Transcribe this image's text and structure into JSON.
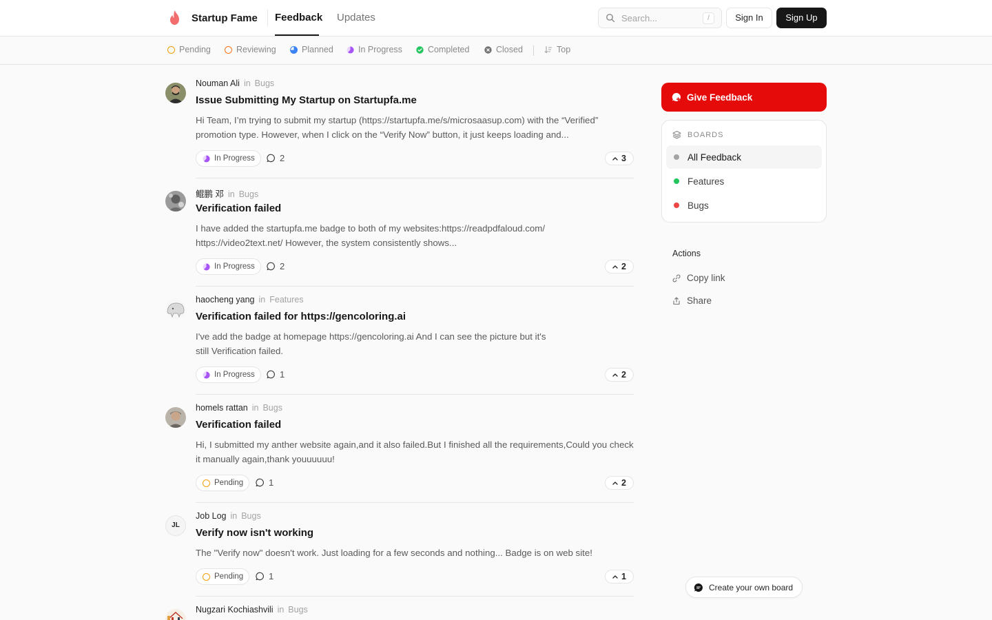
{
  "header": {
    "brand": "Startup Fame",
    "tabs": [
      {
        "label": "Feedback",
        "active": true
      },
      {
        "label": "Updates",
        "active": false
      }
    ],
    "search_placeholder": "Search...",
    "search_shortcut": "/",
    "sign_in": "Sign In",
    "sign_up": "Sign Up"
  },
  "status_filters": [
    {
      "label": "Pending",
      "icon": "pending-ring-icon",
      "color": "#f59e0b"
    },
    {
      "label": "Reviewing",
      "icon": "reviewing-ring-icon",
      "color": "#f97316"
    },
    {
      "label": "Planned",
      "icon": "planned-icon",
      "color": "#3b82f6"
    },
    {
      "label": "In Progress",
      "icon": "in-progress-icon",
      "color": "#a855f7"
    },
    {
      "label": "Completed",
      "icon": "completed-check-icon",
      "color": "#22c55e"
    },
    {
      "label": "Closed",
      "icon": "closed-x-icon",
      "color": "#737373"
    },
    {
      "label": "Top",
      "icon": "sort-icon",
      "color": "#a3a3a3"
    }
  ],
  "posts": [
    {
      "author": "Nouman Ali",
      "in": "in",
      "board": "Bugs",
      "title": "Issue Submitting My Startup on Startupfa.me",
      "description": "Hi Team, I’m trying to submit my startup (https://startupfa.me/s/microsaasup.com) with the “Verified” promotion type. However, when I click on the “Verify Now” button, it just keeps loading and...",
      "status": "In Progress",
      "comments": "2",
      "upvotes": "3"
    },
    {
      "author": "鲲鹏 邓",
      "in": "in",
      "board": "Bugs",
      "title": "Verification failed",
      "description": "I have added the startupfa.me badge to both of my websites:https://readpdfaloud.com/ https://video2text.net/ However, the system consistently shows...",
      "status": "In Progress",
      "comments": "2",
      "upvotes": "2"
    },
    {
      "author": "haocheng yang",
      "in": "in",
      "board": "Features",
      "title": "Verification failed for https://gencoloring.ai",
      "description_lines": [
        "I've add the badge at homepage https://gencoloring.ai  And I can see the picture but it's",
        "still Verification failed."
      ],
      "status": "In Progress",
      "comments": "1",
      "upvotes": "2"
    },
    {
      "author": "homels rattan",
      "in": "in",
      "board": "Bugs",
      "title": "Verification failed",
      "description": "Hi, I submitted my anther website again,and it also failed.But I finished all the requirements,Could you check it manually again,thank youuuuuu!",
      "status": "Pending",
      "comments": "1",
      "upvotes": "2"
    },
    {
      "author": "Job Log",
      "initials": "JL",
      "in": "in",
      "board": "Bugs",
      "title": "Verify now isn't working",
      "description": "The \"Verify now\" doesn't work. Just loading for a few seconds and nothing... Badge is on web site!",
      "status": "Pending",
      "comments": "1",
      "upvotes": "1"
    },
    {
      "author": "Nugzari Kochiashvili",
      "in": "in",
      "board": "Bugs"
    }
  ],
  "sidebar": {
    "give_feedback": "Give Feedback",
    "boards_heading": "BOARDS",
    "boards": [
      {
        "label": "All Feedback",
        "color": "#a3a3a3",
        "active": true
      },
      {
        "label": "Features",
        "color": "#22c55e",
        "active": false
      },
      {
        "label": "Bugs",
        "color": "#ef4444",
        "active": false
      }
    ],
    "actions_heading": "Actions",
    "actions": [
      {
        "label": "Copy link",
        "icon": "link-icon"
      },
      {
        "label": "Share",
        "icon": "share-icon"
      }
    ]
  },
  "create_board": "Create your own board",
  "colors": {
    "accent": "#e50b0b",
    "dark": "#171717"
  }
}
